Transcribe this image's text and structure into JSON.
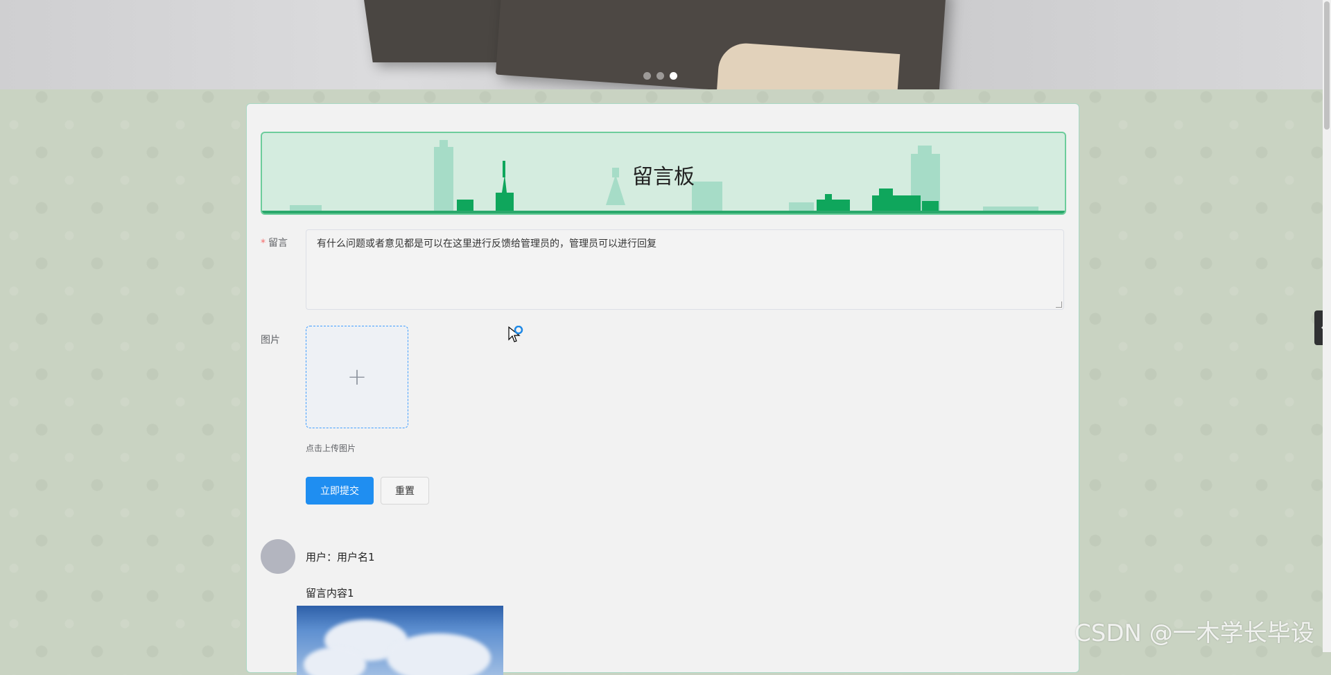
{
  "carousel": {
    "slide_count": 3,
    "active_index": 2
  },
  "board": {
    "title": "留言板"
  },
  "form": {
    "message_label": "留言",
    "message_value": "有什么问题或者意见都是可以在这里进行反馈给管理员的，管理员可以进行回复",
    "image_label": "图片",
    "upload_icon": "plus-icon",
    "upload_tip": "点击上传图片",
    "submit_label": "立即提交",
    "reset_label": "重置"
  },
  "messages": [
    {
      "user": "用户：用户名1",
      "content": "留言内容1"
    }
  ],
  "watermark": "CSDN @一木学长毕设",
  "colors": {
    "primary": "#1f8ef1",
    "banner_bg": "#d4ecdf",
    "banner_border": "#6ccc9b"
  }
}
